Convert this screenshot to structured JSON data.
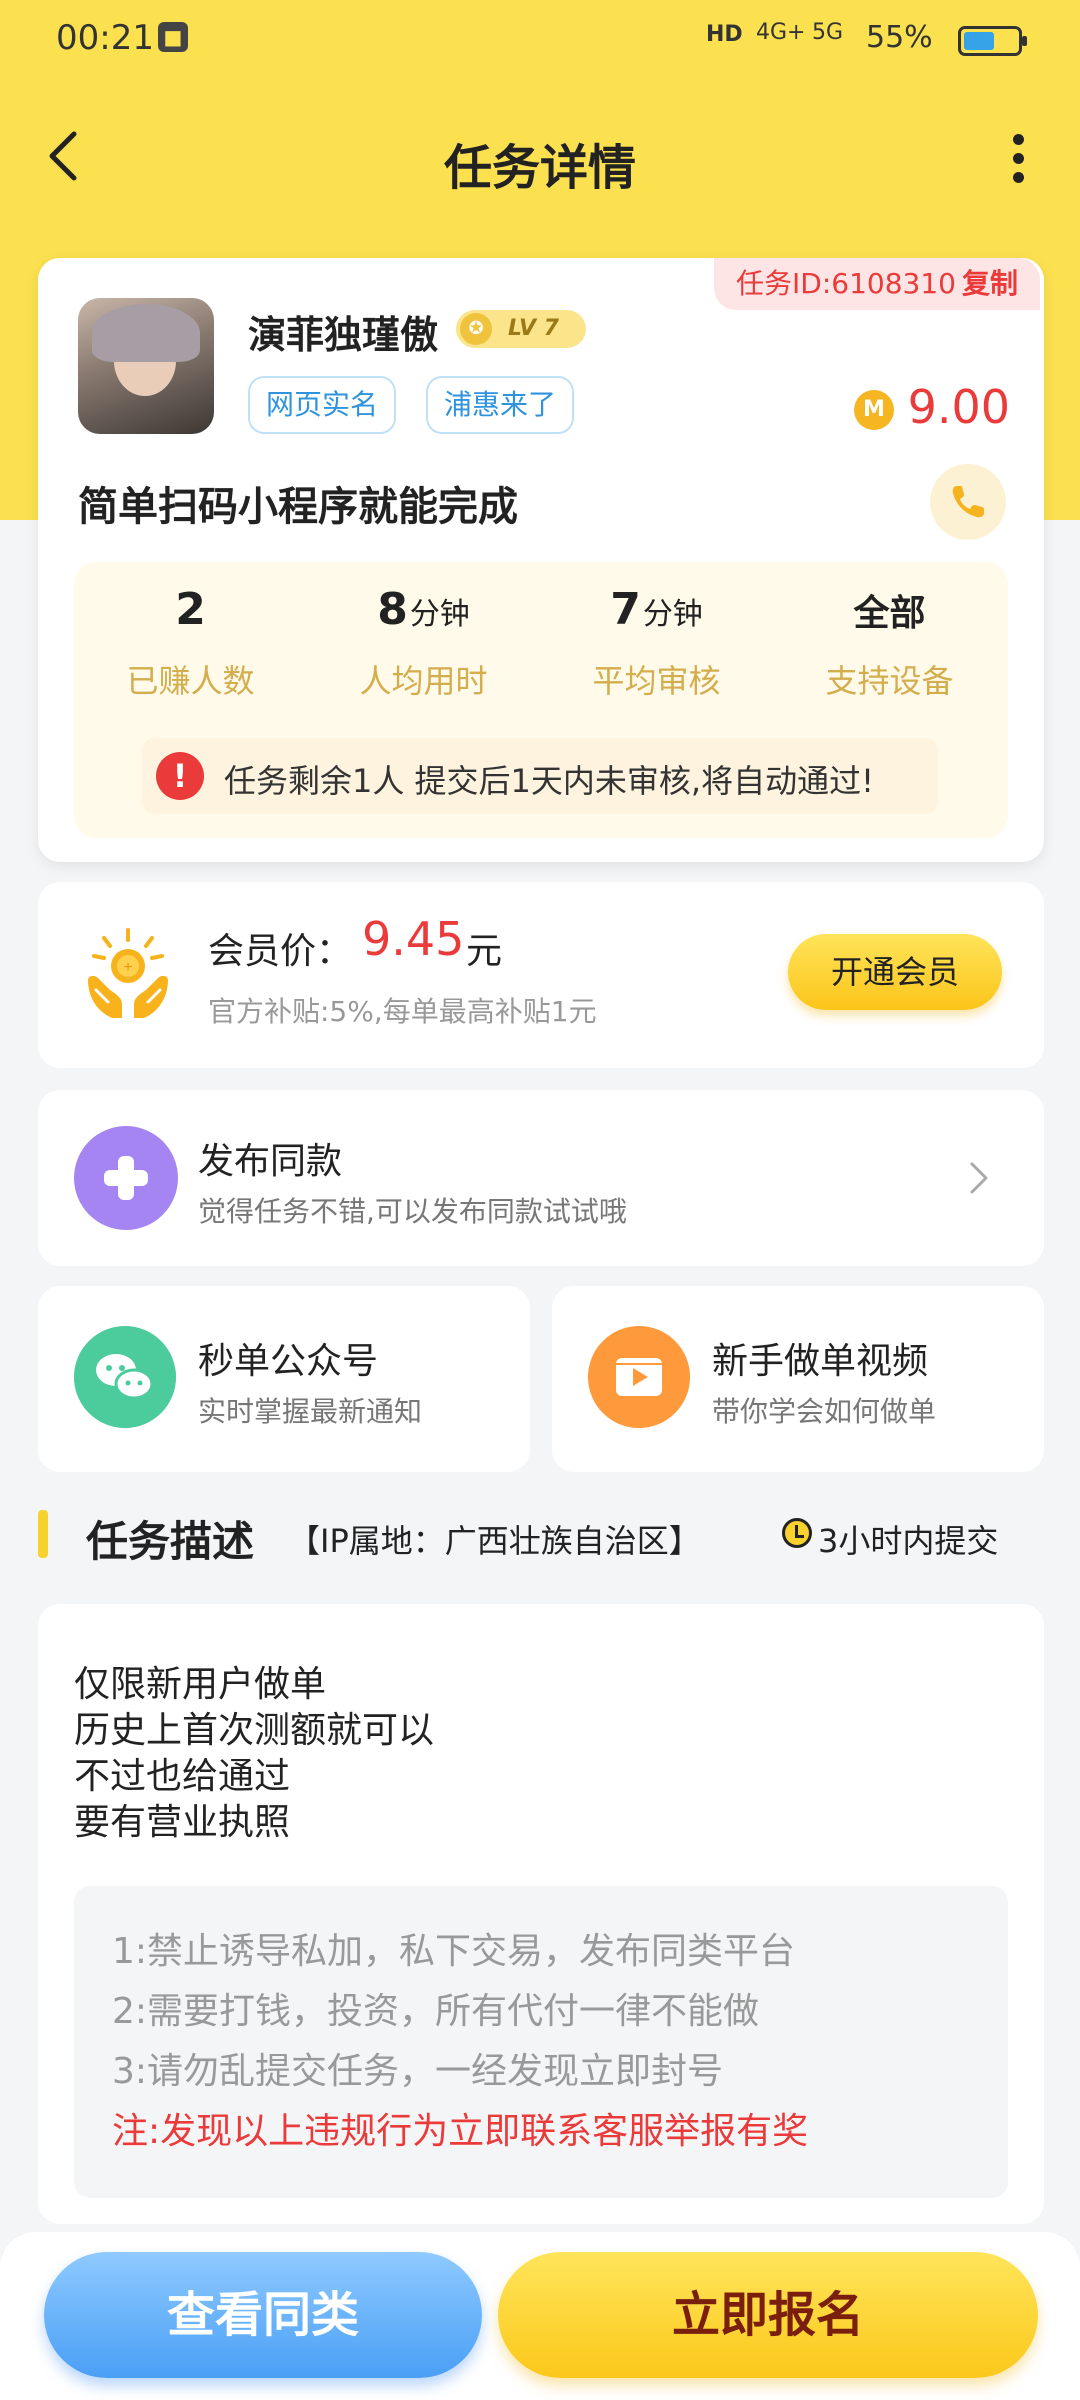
{
  "status_bar": {
    "time": "00:21",
    "hd": "HD",
    "net1": "4G+",
    "net2": "5G",
    "battery": "55%"
  },
  "header": {
    "title": "任务详情"
  },
  "task": {
    "task_id_label": "任务ID:6108310",
    "copy_label": "复制",
    "user_name": "演菲独瑾傲",
    "level": "LV 7",
    "tags": [
      "网页实名",
      "浦惠来了"
    ],
    "reward": "9.00",
    "coin_symbol": "M",
    "title": "简单扫码小程序就能完成",
    "stats": [
      {
        "value": "2",
        "unit": "",
        "label": "已赚人数"
      },
      {
        "value": "8",
        "unit": "分钟",
        "label": "人均用时"
      },
      {
        "value": "7",
        "unit": "分钟",
        "label": "平均审核"
      },
      {
        "value": "全部",
        "unit": "",
        "label": "支持设备"
      }
    ],
    "notice": "任务剩余1人  提交后1天内未审核,将自动通过!"
  },
  "member": {
    "label": "会员价：",
    "price": "9.45",
    "unit": "元",
    "subtitle": "官方补贴:5%,每单最高补贴1元",
    "button": "开通会员"
  },
  "publish": {
    "title": "发布同款",
    "subtitle": "觉得任务不错,可以发布同款试试哦"
  },
  "wechat": {
    "title": "秒单公众号",
    "subtitle": "实时掌握最新通知"
  },
  "video": {
    "title": "新手做单视频",
    "subtitle": "带你学会如何做单"
  },
  "description": {
    "title": "任务描述",
    "ip": "【IP属地：广西壮族自治区】",
    "time_limit": "3小时内提交",
    "lines": [
      "仅限新用户做单",
      "历史上首次测额就可以",
      "不过也给通过",
      "要有营业执照"
    ],
    "rules": [
      "1:禁止诱导私加，私下交易，发布同类平台",
      "2:需要打钱，投资，所有代付一律不能做",
      "3:请勿乱提交任务，一经发现立即封号"
    ],
    "warning": "注:发现以上违规行为立即联系客服举报有奖"
  },
  "bottom": {
    "similar_button": "查看同类",
    "apply_button": "立即报名"
  },
  "colors": {
    "brand_yellow": "#fbe04f",
    "accent_red": "#ea3a3a",
    "tag_blue": "#2f93de"
  }
}
